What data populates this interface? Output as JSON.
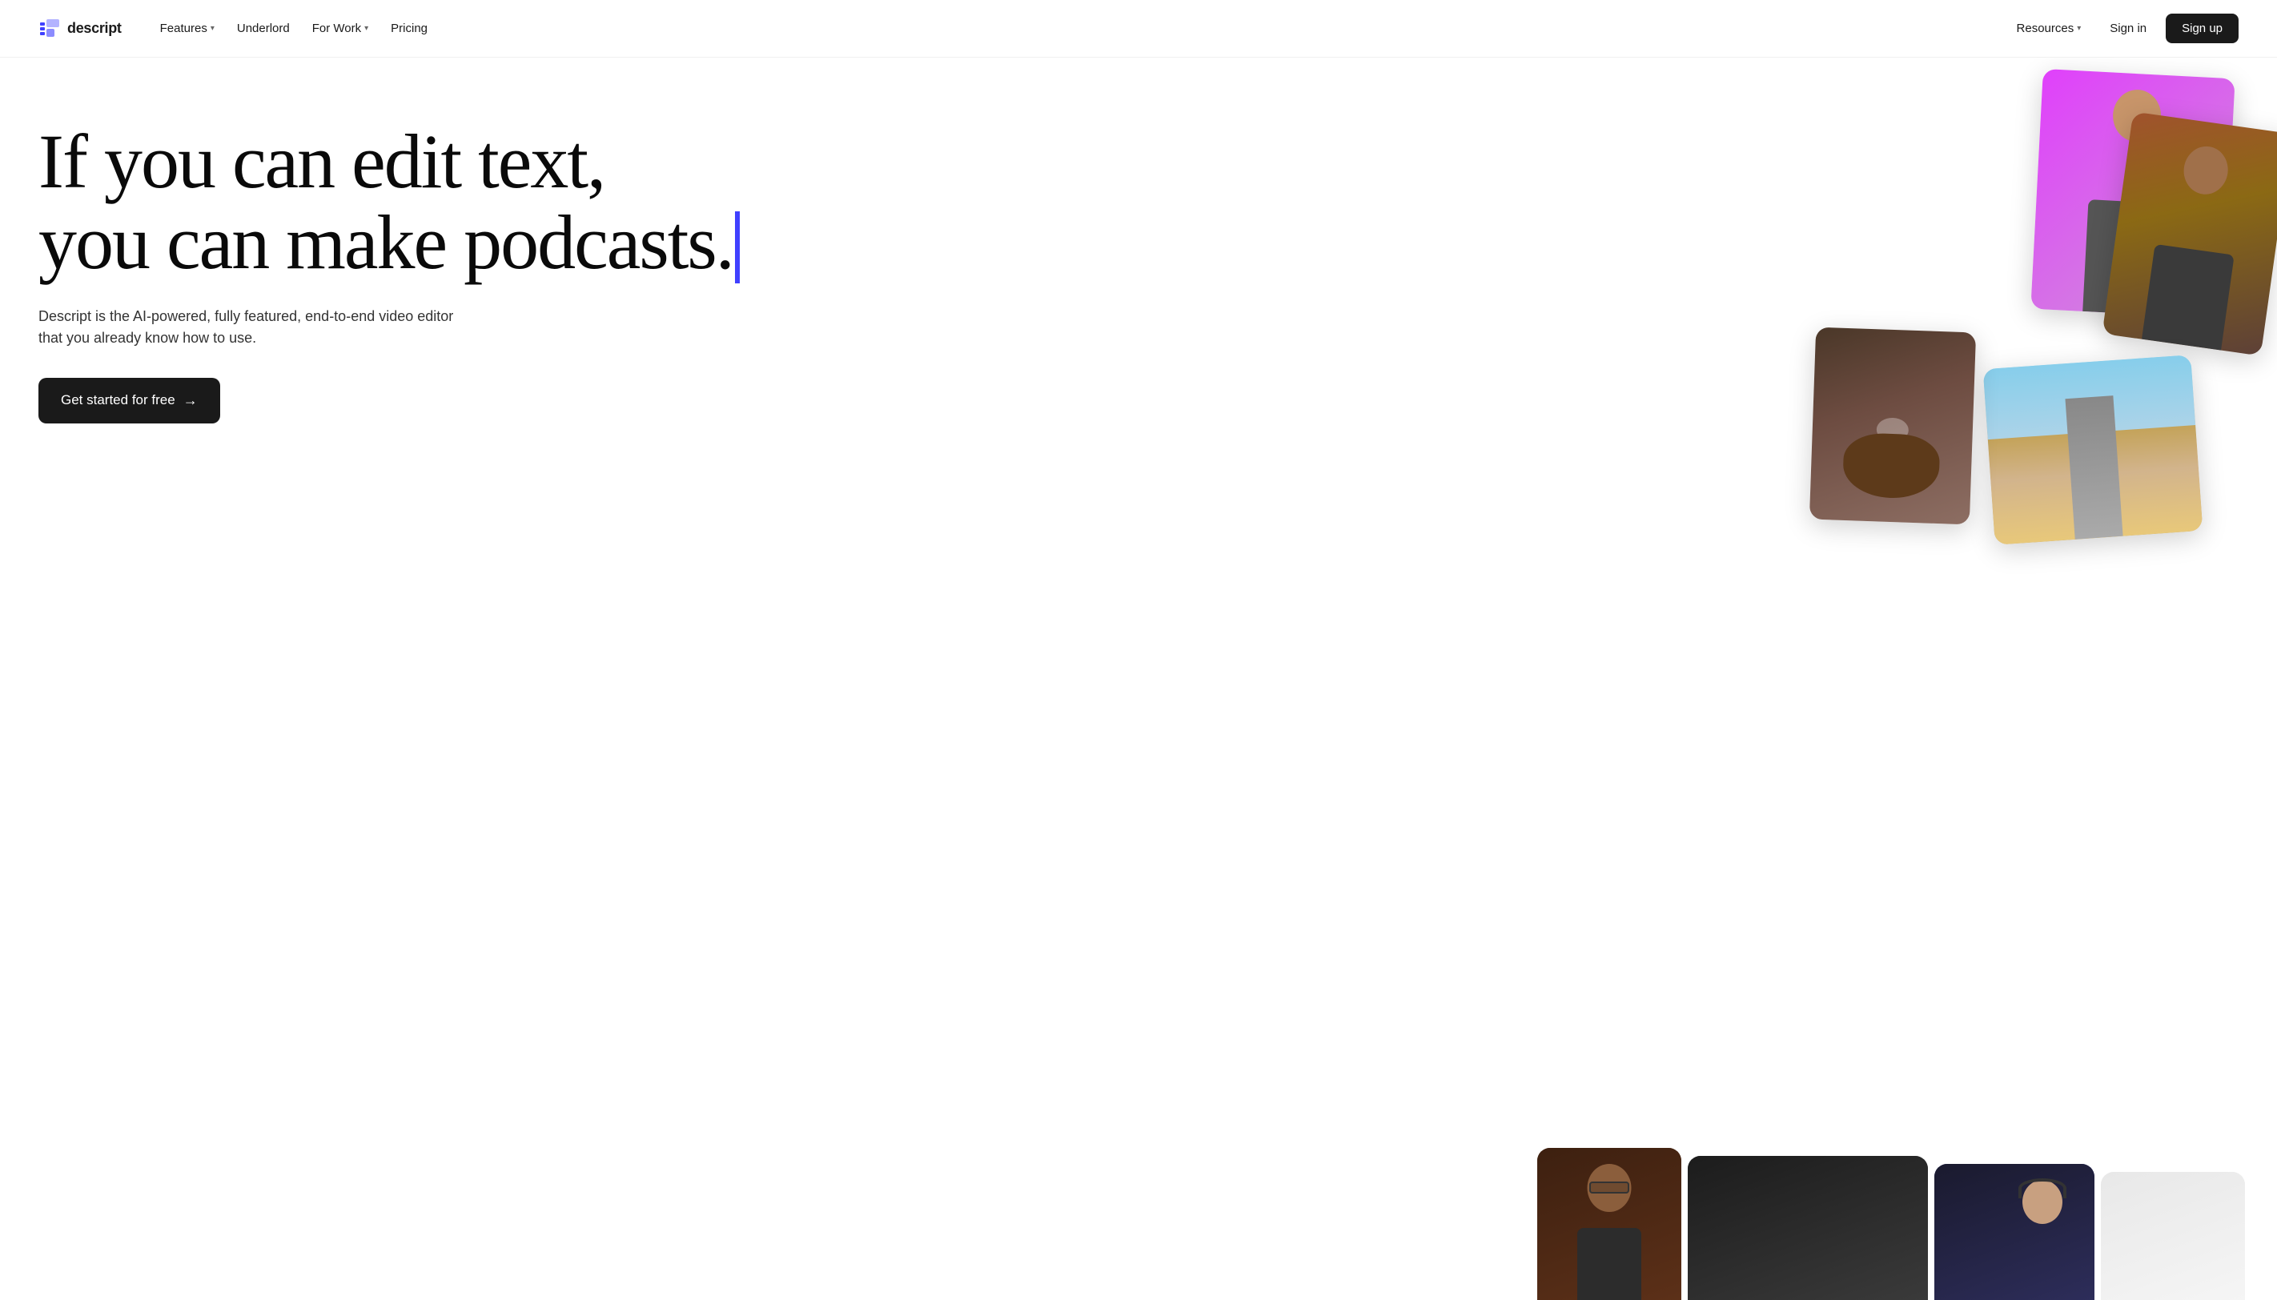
{
  "brand": {
    "name": "descript",
    "logo_alt": "Descript logo"
  },
  "nav": {
    "left": [
      {
        "label": "Features",
        "has_dropdown": true,
        "id": "features"
      },
      {
        "label": "Underlord",
        "has_dropdown": false,
        "id": "underlord"
      },
      {
        "label": "For Work",
        "has_dropdown": true,
        "id": "for-work"
      },
      {
        "label": "Pricing",
        "has_dropdown": false,
        "id": "pricing"
      }
    ],
    "right": [
      {
        "label": "Resources",
        "has_dropdown": true,
        "id": "resources"
      },
      {
        "label": "Sign in",
        "id": "signin"
      },
      {
        "label": "Sign up",
        "id": "signup"
      }
    ]
  },
  "hero": {
    "headline_line1": "If you can edit text,",
    "headline_line2": "you can make podcasts.",
    "subtitle": "Descript is the AI-powered, fully featured, end-to-end video editor that you already know how to use.",
    "cta_label": "Get started for free",
    "cta_arrow": "→"
  }
}
